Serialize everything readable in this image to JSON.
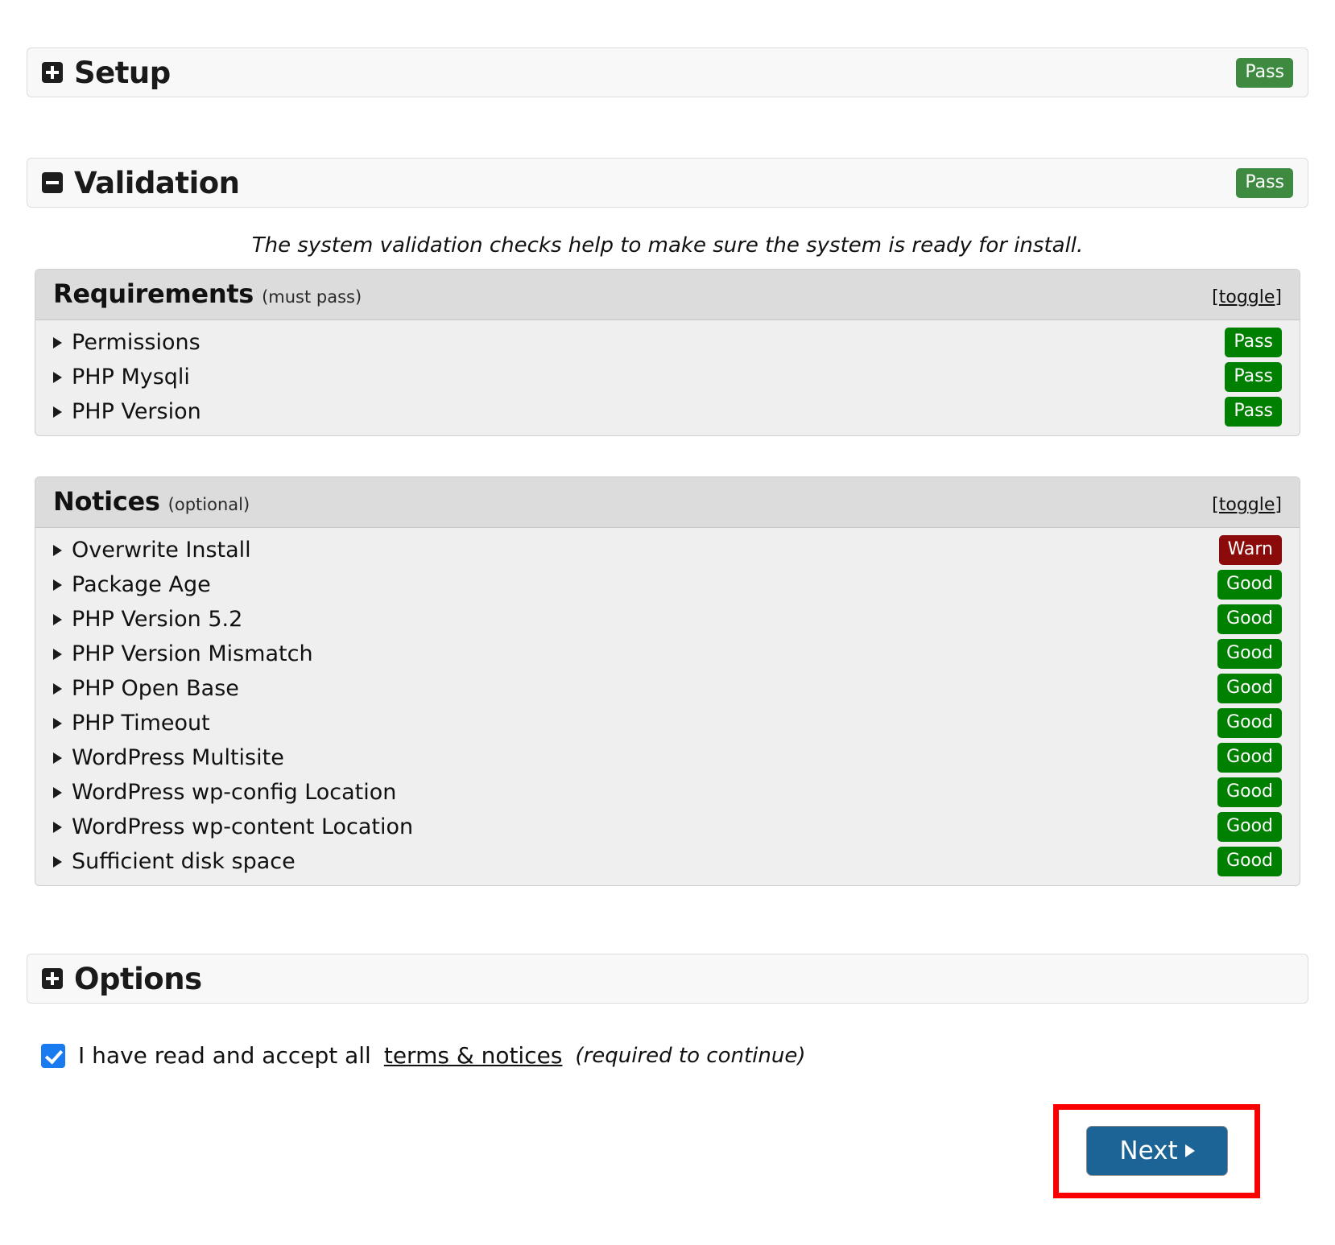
{
  "setup": {
    "title": "Setup",
    "icon": "plus-square-icon",
    "status": "Pass",
    "collapsed": true
  },
  "validation": {
    "title": "Validation",
    "icon": "minus-square-icon",
    "status": "Pass",
    "collapsed": false,
    "description": "The system validation checks help to make sure the system is ready for install.",
    "groups": [
      {
        "name": "Requirements",
        "note": "(must pass)",
        "toggle_label": "[toggle]",
        "items": [
          {
            "label": "Permissions",
            "status": "Pass",
            "status_kind": "pass"
          },
          {
            "label": "PHP Mysqli",
            "status": "Pass",
            "status_kind": "pass"
          },
          {
            "label": "PHP Version",
            "status": "Pass",
            "status_kind": "pass"
          }
        ]
      },
      {
        "name": "Notices",
        "note": "(optional)",
        "toggle_label": "[toggle]",
        "items": [
          {
            "label": "Overwrite Install",
            "status": "Warn",
            "status_kind": "warn"
          },
          {
            "label": "Package Age",
            "status": "Good",
            "status_kind": "good"
          },
          {
            "label": "PHP Version 5.2",
            "status": "Good",
            "status_kind": "good"
          },
          {
            "label": "PHP Version Mismatch",
            "status": "Good",
            "status_kind": "good"
          },
          {
            "label": "PHP Open Base",
            "status": "Good",
            "status_kind": "good"
          },
          {
            "label": "PHP Timeout",
            "status": "Good",
            "status_kind": "good"
          },
          {
            "label": "WordPress Multisite",
            "status": "Good",
            "status_kind": "good"
          },
          {
            "label": "WordPress wp-config Location",
            "status": "Good",
            "status_kind": "good"
          },
          {
            "label": "WordPress wp-content Location",
            "status": "Good",
            "status_kind": "good"
          },
          {
            "label": "Sufficient disk space",
            "status": "Good",
            "status_kind": "good"
          }
        ]
      }
    ]
  },
  "options": {
    "title": "Options",
    "icon": "plus-square-icon",
    "collapsed": true
  },
  "terms": {
    "checked": true,
    "text_before": "I have read and accept all",
    "link_label": "terms & notices",
    "required_note": "(required to continue)"
  },
  "footer": {
    "next_label": "Next",
    "next_icon": "triangle-right-icon",
    "highlight_color": "#fa0000"
  },
  "colors": {
    "pass_muted": "#3e8a41",
    "pass": "#008000",
    "good": "#008000",
    "warn": "#8b0b0b",
    "checkbox": "#1a7bf0",
    "next_button": "#1c6496",
    "highlight": "#fa0000"
  }
}
